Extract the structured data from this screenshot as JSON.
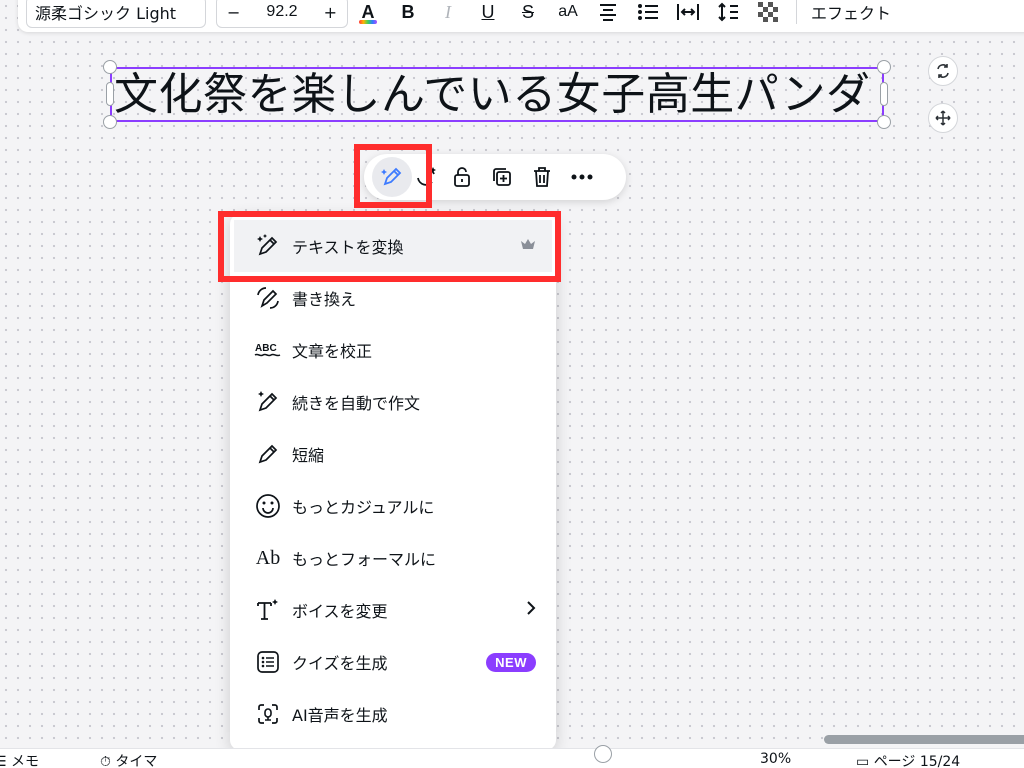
{
  "toolbar": {
    "font_name": "源柔ゴシック Light",
    "minus": "−",
    "font_size": "92.2",
    "plus": "+",
    "color_letter": "A",
    "bold": "B",
    "italic": "I",
    "underline": "U",
    "strike": "S",
    "case": "aA",
    "effects": "エフェクト"
  },
  "canvas": {
    "text": "文化祭を楽しんでいる女子高生パンダ"
  },
  "menu": {
    "items": [
      {
        "label": "テキストを変換",
        "icon": "magic-pen-icon"
      },
      {
        "label": "書き換え",
        "icon": "rewrite-icon"
      },
      {
        "label": "文章を校正",
        "icon": "abc-spellcheck-icon"
      },
      {
        "label": "続きを自動で作文",
        "icon": "pen-sparkle-icon"
      },
      {
        "label": "短縮",
        "icon": "pen-icon"
      },
      {
        "label": "もっとカジュアルに",
        "icon": "smile-icon"
      },
      {
        "label": "もっとフォーマルに",
        "icon": "ab-icon"
      },
      {
        "label": "ボイスを変更",
        "icon": "text-sparkle-icon"
      },
      {
        "label": "クイズを生成",
        "icon": "quiz-list-icon"
      },
      {
        "label": "AI音声を生成",
        "icon": "ai-voice-icon"
      }
    ],
    "ab_glyph": "Ab",
    "new_badge": "NEW",
    "chevron": "›"
  },
  "bottom": {
    "notes": "メモ",
    "timer": "タイマ",
    "zoom": "30%",
    "pages": "ページ 15/24"
  },
  "colors": {
    "accent_purple": "#8b3dff",
    "highlight_red": "#ff2d2d"
  }
}
